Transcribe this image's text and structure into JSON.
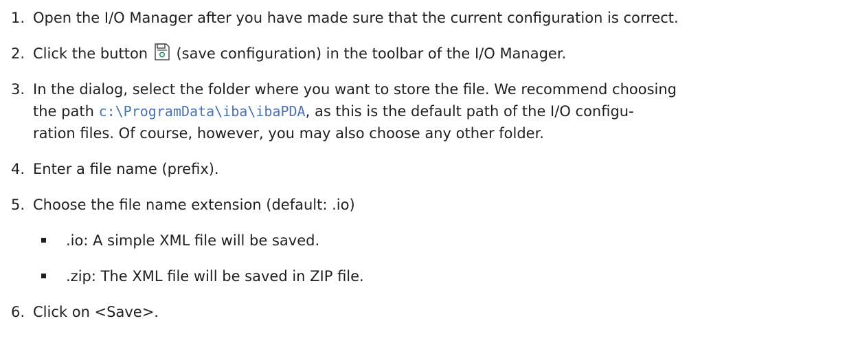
{
  "steps": [
    {
      "num": "1.",
      "text": "Open the I/O Manager after you have made sure that the current configuration is correct."
    },
    {
      "num": "2.",
      "text_before": "Click the button",
      "text_after": " (save configuration) in the toolbar of the I/O Manager."
    },
    {
      "num": "3.",
      "line1": "In the dialog, select the folder where you want to store the file. We recommend choosing",
      "line2_before": "the path ",
      "path": "c:\\ProgramData\\iba\\ibaPDA",
      "line2_after": ", as this is the default path of the I/O configu-",
      "line3": "ration files. Of course, however, you may also choose any other folder."
    },
    {
      "num": "4.",
      "text": "Enter a file name (prefix)."
    },
    {
      "num": "5.",
      "text": "Choose the file name extension (default: .io)"
    },
    {
      "num": "6.",
      "text": "Click on <Save>."
    }
  ],
  "bullets": [
    ".io: A simple XML file will be saved.",
    ".zip: The XML file will be saved in ZIP file."
  ],
  "icons": {
    "save": "save-configuration-icon"
  }
}
